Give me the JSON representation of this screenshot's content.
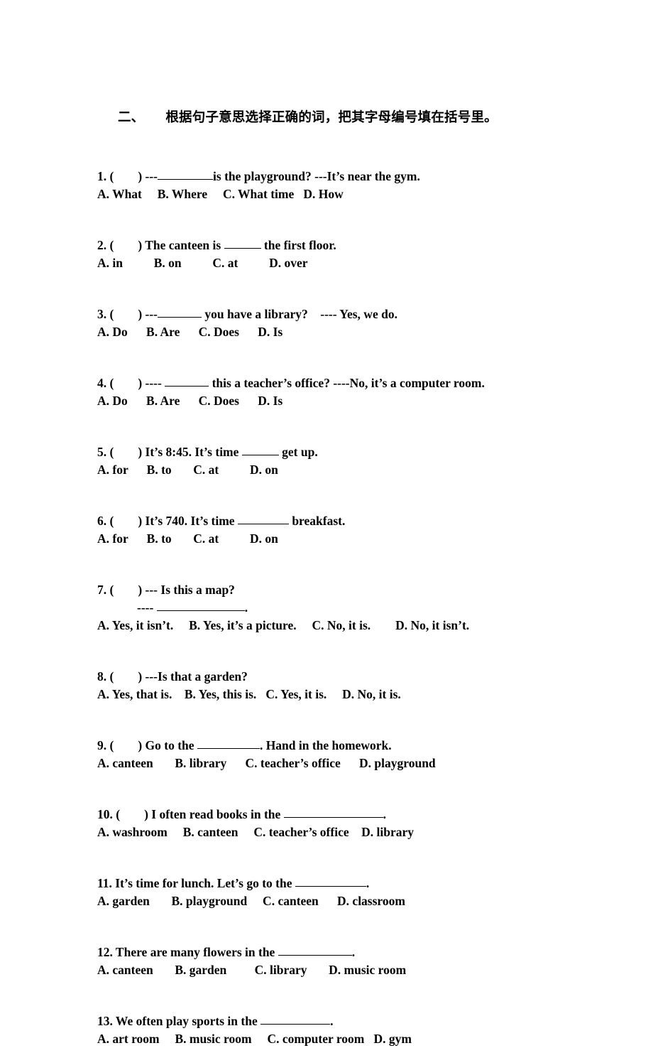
{
  "section": {
    "number": "二、",
    "title": "根据句子意思选择正确的词，把其字母编号填在括号里。"
  },
  "questions": [
    {
      "id": "q1",
      "number": "1. (",
      "paren_close": ")",
      "pre": " ---",
      "blank_width": 78,
      "post": "is the playground? ---It’s near the gym.",
      "options": "A. What     B. Where     C. What time   D. How"
    },
    {
      "id": "q2",
      "number": "2. (",
      "paren_close": ")",
      "pre": " The canteen is ",
      "blank_width": 52,
      "post": " the first floor.",
      "options": "A. in          B. on          C. at          D. over"
    },
    {
      "id": "q3",
      "number": "3. (",
      "paren_close": ")",
      "pre": " ---",
      "blank_width": 62,
      "post": " you have a library?    ---- Yes, we do.",
      "options": "A. Do      B. Are      C. Does      D. Is"
    },
    {
      "id": "q4",
      "number": "4. (",
      "paren_close": ")",
      "pre": " ---- ",
      "blank_width": 62,
      "post": " this a teacher’s office? ----No, it’s a computer room.",
      "options": "A. Do      B. Are      C. Does      D. Is"
    },
    {
      "id": "q5",
      "number": "5. (",
      "paren_close": ")",
      "pre": " It’s 8:45. It’s time ",
      "blank_width": 52,
      "post": " get up.",
      "options": "A. for      B. to       C. at          D. on"
    },
    {
      "id": "q6",
      "number": "6. (",
      "paren_close": ")",
      "pre": " It’s 740. It’s time ",
      "blank_width": 72,
      "post": " breakfast.",
      "options": "A. for      B. to       C. at          D. on"
    },
    {
      "id": "q7",
      "number": "7. (",
      "paren_close": ")",
      "pre": " --- Is this a map?",
      "blank_width": 0,
      "post": "",
      "sub_dash": "---- ",
      "sub_blank_width": 124,
      "sub_post": ".",
      "options": "A. Yes, it isn’t.     B. Yes, it’s a picture.     C. No, it is.        D. No, it isn’t."
    },
    {
      "id": "q8",
      "number": "8. (",
      "paren_close": ")",
      "pre": " ---Is that a garden?",
      "blank_width": 0,
      "post": "",
      "options": "A. Yes, that is.    B. Yes, this is.   C. Yes, it is.     D. No, it is."
    },
    {
      "id": "q9",
      "number": "9. (",
      "paren_close": ")",
      "pre": " Go to the ",
      "blank_width": 88,
      "post": ". Hand in the homework.",
      "options": "A. canteen       B. library      C. teacher’s office      D. playground"
    },
    {
      "id": "q10",
      "number": "10. (",
      "paren_close": ")",
      "pre": " I often read books in the ",
      "blank_width": 140,
      "post": ".",
      "options": "A. washroom     B. canteen     C. teacher’s office    D. library"
    },
    {
      "id": "q11",
      "number": "11.",
      "paren_close": "",
      "pre": " It’s time for lunch. Let’s go to the ",
      "blank_width": 100,
      "post": ".",
      "options": "A. garden       B. playground     C. canteen      D. classroom"
    },
    {
      "id": "q12",
      "number": "12.",
      "paren_close": "",
      "pre": " There are many flowers in the ",
      "blank_width": 104,
      "post": ".",
      "options": "A. canteen       B. garden         C. library       D. music room"
    },
    {
      "id": "q13",
      "number": "13.",
      "paren_close": "",
      "pre": " We often play sports in the ",
      "blank_width": 98,
      "post": ".",
      "options": "A. art room     B. music room     C. computer room   D. gym"
    }
  ]
}
